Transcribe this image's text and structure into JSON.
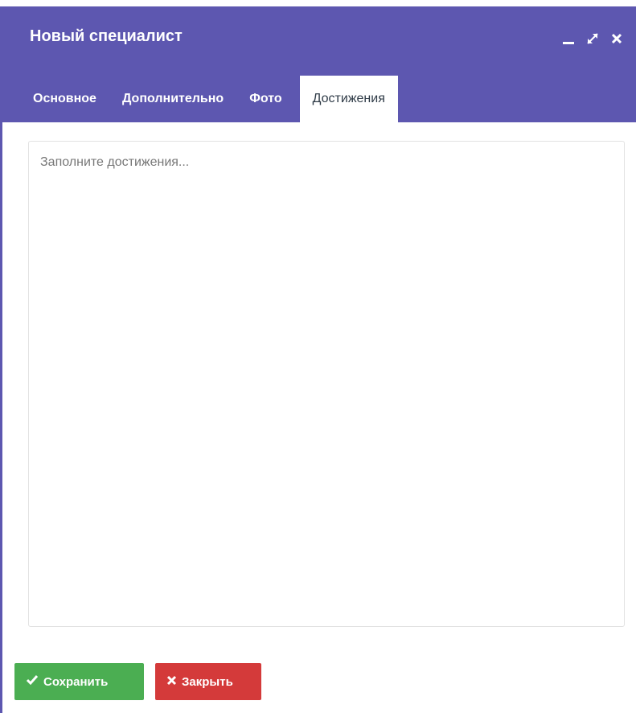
{
  "window": {
    "title": "Новый специалист",
    "controls": {
      "minimize_icon": "minimize-icon",
      "maximize_icon": "maximize-icon",
      "close_icon": "close-icon"
    }
  },
  "tabs": [
    {
      "label": "Основное",
      "active": false
    },
    {
      "label": "Дополнительно",
      "active": false
    },
    {
      "label": "Фото",
      "active": false
    },
    {
      "label": "Достижения",
      "active": true
    }
  ],
  "achievements": {
    "value": "",
    "placeholder": "Заполните достижения..."
  },
  "footer": {
    "save_label": "Сохранить",
    "save_icon": "check-icon",
    "close_label": "Закрыть",
    "close_icon": "x-icon"
  },
  "colors": {
    "header": "#5d57b0",
    "save": "#4bae52",
    "close": "#d43a3a"
  }
}
